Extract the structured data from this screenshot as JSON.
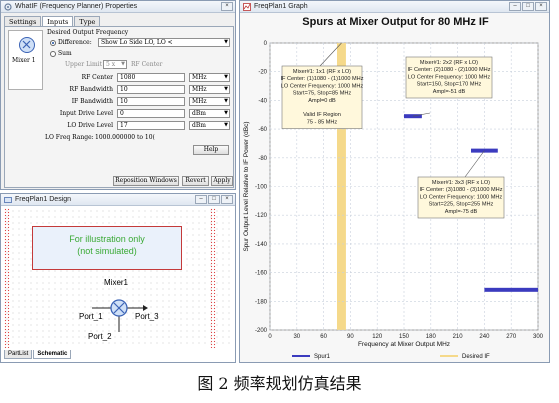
{
  "props_window": {
    "title": "WhatIF (Frequency Planner) Properties",
    "tabs": [
      "Settings",
      "Inputs",
      "Type"
    ],
    "mixer_label": "Mixer 1",
    "section_label": "Desired Output Frequency",
    "difference_label": "Difference:",
    "difference_value": "Show Lo Side LO, LO <",
    "sum_label": "Sum",
    "upper_limit_label": "Upper Limit",
    "upper_limit_value": "5 x",
    "rf_center_suffix": "RF Center",
    "rows": [
      {
        "label": "RF Center",
        "value": "1080",
        "unit": "MHz"
      },
      {
        "label": "RF Bandwidth",
        "value": "10",
        "unit": "MHz"
      },
      {
        "label": "IF Bandwidth",
        "value": "10",
        "unit": "MHz"
      },
      {
        "label": "Input Drive Level",
        "value": "0",
        "unit": "dBm"
      },
      {
        "label": "LO Drive Level",
        "value": "17",
        "unit": "dBm"
      }
    ],
    "lo_freq_label": "LO Freq Range:",
    "lo_freq_value": "1000.000000 to 10(",
    "help_button": "Help",
    "reposition_button": "Reposition Windows",
    "revert_button": "Revert",
    "apply_button": "Apply"
  },
  "design_window": {
    "title": "FreqPlan1 Design",
    "note_line1": "For illustration only",
    "note_line2": "(not simulated)",
    "mixer_label": "Mixer1",
    "port1": "Port_1",
    "port2": "Port_2",
    "port3": "Port_3",
    "tabs": [
      "PartList",
      "Schematic"
    ]
  },
  "graph_window": {
    "title": "FreqPlan1 Graph"
  },
  "chart_data": {
    "type": "bar",
    "title": "Spurs at Mixer Output for 80 MHz IF",
    "xlabel": "Frequency at Mixer Output MHz",
    "ylabel": "Spur Output Level Relative to IF Power (dBc)",
    "xlim": [
      0,
      300
    ],
    "ylim": [
      -200,
      0
    ],
    "xticks": [
      0,
      30,
      60,
      90,
      120,
      150,
      180,
      210,
      240,
      270,
      300
    ],
    "yticks": [
      0,
      -20,
      -40,
      -60,
      -80,
      -100,
      -120,
      -140,
      -160,
      -180,
      -200
    ],
    "grid": true,
    "series": [
      {
        "name": "Spur1",
        "color": "#3b3bbf",
        "segments": [
          {
            "x_start": 150,
            "x_end": 170,
            "y": -51
          },
          {
            "x_start": 225,
            "x_end": 255,
            "y": -75
          },
          {
            "x_start": 240,
            "x_end": 300,
            "y": -172
          }
        ]
      },
      {
        "name": "Desired IF",
        "color": "#f5d98a",
        "band": {
          "x_start": 75,
          "x_end": 85
        }
      }
    ],
    "annotations": [
      {
        "lines": [
          "Mixer#1: 1x1 (RF x LO)",
          "IF Center: (1)1080 - (1)1000 MHz",
          "LO Center Frequency: 1000 MHz",
          "Start=75, Stop=85 MHz",
          "Ampl=0 dB",
          "",
          "Valid IF Region",
          "75 - 85 MHz"
        ]
      },
      {
        "lines": [
          "Mixer#1: 2x2 (RF x LO)",
          "IF Center: (2)1080 - (2)1000 MHz",
          "LO Center Frequency: 1000 MHz",
          "Start=150, Stop=170 MHz",
          "Ampl=-51 dB"
        ]
      },
      {
        "lines": [
          "Mixer#1: 3x3 (RF x LO)",
          "IF Center: (3)1080 - (3)1000 MHz",
          "LO Center Frequency: 1000 MHz",
          "Start=225, Stop=255 MHz",
          "Ampl=-75 dB"
        ]
      }
    ]
  },
  "caption": "图 2  频率规划仿真结果"
}
